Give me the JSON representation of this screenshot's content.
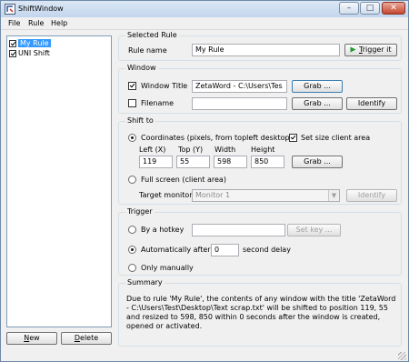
{
  "window": {
    "title": "ShiftWindow",
    "minimize_glyph": "–",
    "maximize_glyph": "□",
    "close_glyph": "✕"
  },
  "menu": {
    "items": [
      "File",
      "Rule",
      "Help"
    ]
  },
  "rules": {
    "items": [
      {
        "label": "My Rule",
        "checked": true,
        "selected": true
      },
      {
        "label": "UNI Shift",
        "checked": true,
        "selected": false
      }
    ],
    "new_prefix": "N",
    "new_rest": "ew",
    "delete_prefix": "D",
    "delete_rest": "elete"
  },
  "selected_rule": {
    "legend": "Selected Rule",
    "name_label": "Rule name",
    "name_value": "My Rule",
    "trigger_prefix": "T",
    "trigger_rest": "rigger it"
  },
  "window_group": {
    "legend": "Window",
    "title_label": "Window Title",
    "title_checked": true,
    "title_value": "ZetaWord - C:\\Users\\Tes",
    "grab_label": "Grab ...",
    "filename_label": "Filename",
    "filename_checked": false,
    "filename_value": "",
    "identify_label": "Identify"
  },
  "shift_to": {
    "legend": "Shift to",
    "coords_label": "Coordinates (pixels, from topleft desktop)",
    "set_size_label": "Set size client area",
    "set_size_checked": true,
    "left_label": "Left (X)",
    "top_label": "Top (Y)",
    "width_label": "Width",
    "height_label": "Height",
    "left": "119",
    "top": "55",
    "width": "598",
    "height": "850",
    "grab_label": "Grab ...",
    "fullscreen_label": "Full screen (client area)",
    "monitor_label": "Target monitor",
    "monitor_value": "Monitor 1",
    "identify_label": "Identify"
  },
  "trigger": {
    "legend": "Trigger",
    "hotkey_label": "By a hotkey",
    "hotkey_value": "",
    "setkey_label": "Set key ...",
    "auto_label": "Automatically after a",
    "delay_value": "0",
    "delay_suffix": "second delay",
    "manual_label": "Only manually"
  },
  "summary": {
    "legend": "Summary",
    "text": "Due to rule 'My Rule', the contents of any window with the title 'ZetaWord - C:\\Users\\Test\\Desktop\\Text scrap.txt' will be shifted to position 119, 55 and resized to 598, 850 within 0 seconds after the window is created, opened or activated."
  }
}
